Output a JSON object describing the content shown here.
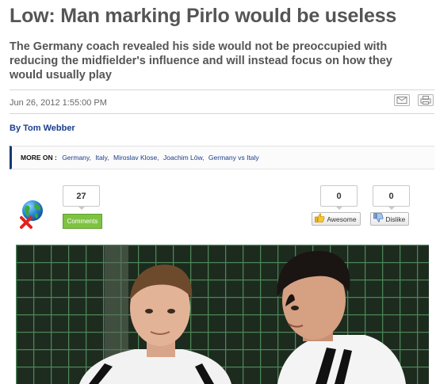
{
  "article": {
    "headline": "Low: Man marking Pirlo would be useless",
    "standfirst": "The Germany coach revealed his side would not be preoccupied with reducing the midfielder's influence and will instead focus on how they would usually play",
    "date": "Jun 26, 2012 1:55:00 PM",
    "byline": "By Tom Webber"
  },
  "tools": {
    "email_icon": "envelope-icon",
    "print_icon": "printer-icon"
  },
  "more_on": {
    "label": "MORE ON :",
    "tags": [
      "Germany",
      "Italy",
      "Miroslav Klose",
      "Joachim Löw",
      "Germany vs Italy"
    ]
  },
  "social": {
    "comments_count": "27",
    "comments_label": "Comments",
    "awesome_count": "0",
    "awesome_label": "Awesome",
    "dislike_count": "0",
    "dislike_label": "Dislike"
  },
  "colors": {
    "accent_green": "#7ec242",
    "link_blue": "#1a3e8c",
    "moreon_border": "#123a73"
  }
}
